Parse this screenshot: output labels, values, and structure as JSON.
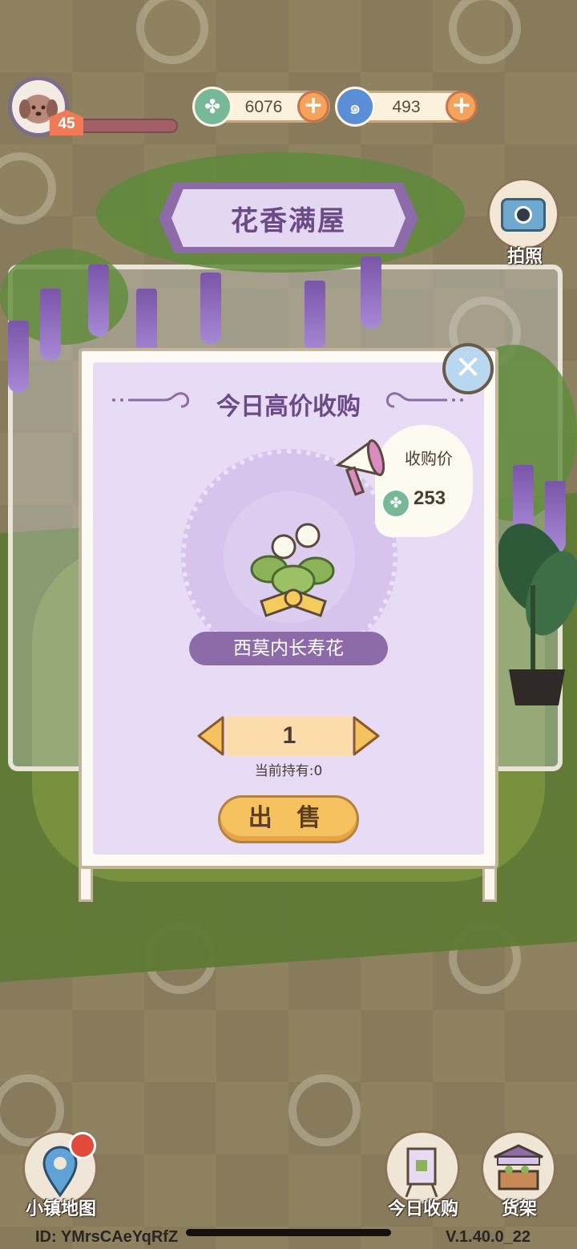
{
  "hud": {
    "level": "45",
    "clover_amount": "6076",
    "gem_amount": "493"
  },
  "header": {
    "title": "花香满屋"
  },
  "camera": {
    "label": "拍照"
  },
  "modal": {
    "title": "今日高价收购",
    "price_label": "收购价",
    "price_value": "253",
    "item_name": "西莫内长寿花",
    "quantity": "1",
    "holding": "当前持有:0",
    "sell_label": "出 售"
  },
  "bottom_nav": {
    "map_label": "小镇地图",
    "purchase_label": "今日收购",
    "shelf_label": "货架"
  },
  "footer": {
    "id_text": "ID: YMrsCAeYqRfZ",
    "version": "V.1.40.0_22"
  },
  "colors": {
    "accent_purple": "#8c6ba8",
    "panel_lavender": "#e7dbf6",
    "sell_orange": "#f6c15f",
    "clover_green": "#77b898"
  }
}
